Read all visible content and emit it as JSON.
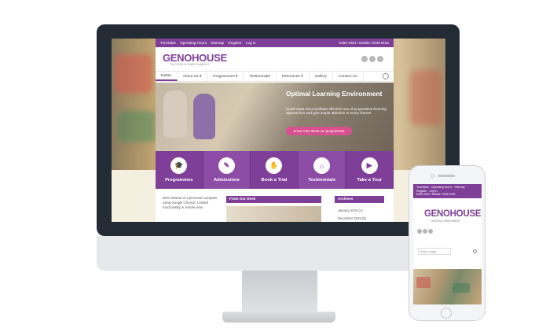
{
  "site": {
    "topbar_links": [
      "Timetable",
      "Operating Hours",
      "Sitemap",
      "Register",
      "Log In"
    ],
    "topbar_phone": "6455 4061 / Mobile: 9236 9155",
    "logo": "GENOHOUSE",
    "logo_tagline": "TUITION & ENRICHMENT",
    "nav": [
      "Home",
      "About Us ▾",
      "Programmes ▾",
      "Testimonials",
      "Resources ▾",
      "Gallery",
      "Contact Us"
    ],
    "hero": {
      "title": "Optimal Learning Environment",
      "text": "Small class sizes facilitate effective use of progressive learning approaches and give ample attention to every learner",
      "button": "Know more about our programmes"
    },
    "tiles": [
      {
        "label": "Programmes",
        "icon": "graduation-cap-icon",
        "glyph": "🎓"
      },
      {
        "label": "Admissions",
        "icon": "pencil-icon",
        "glyph": "✎"
      },
      {
        "label": "Book a Trial",
        "icon": "handshake-icon",
        "glyph": "✋"
      },
      {
        "label": "Testimonials",
        "icon": "home-icon",
        "glyph": "⌂"
      },
      {
        "label": "Take a Tour",
        "icon": "play-icon",
        "glyph": "▶"
      }
    ],
    "notice": "Best viewed on a personal computer using Google Chrome. Limited functionality in mobile view.",
    "desk_heading": "From Our Desk",
    "archives_heading": "Archives",
    "archives": [
      "January 2016 (1)",
      "December 2015 (5)"
    ]
  },
  "phone": {
    "topbar_line1": "Timetable · Operating Hours · Sitemap",
    "topbar_line2": "Register · Log In",
    "topbar_phone": "6455 4061 / Mobile: 9236 9155",
    "logo": "GENOHOUSE",
    "logo_tagline": "TUITION & ENRICHMENT",
    "select_placeholder": "Select a page"
  },
  "colors": {
    "brand": "#7f3f98",
    "accent": "#d9508f",
    "monitor": "#232b35"
  }
}
